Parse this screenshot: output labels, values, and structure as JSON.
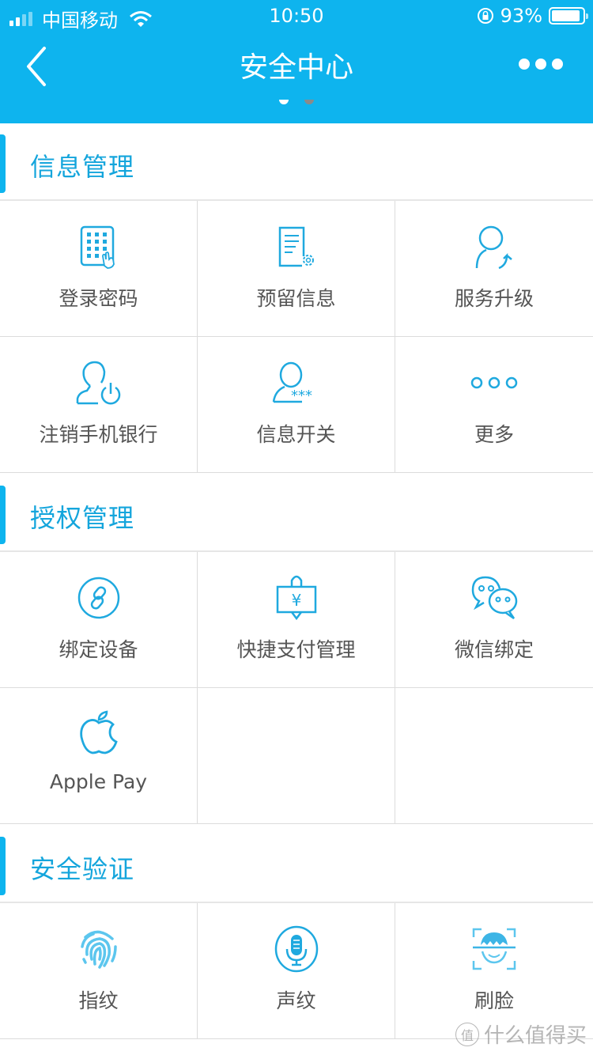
{
  "status_bar": {
    "carrier": "中国移动",
    "time": "10:50",
    "battery_percent_text": "93%",
    "battery_level": 0.93
  },
  "nav": {
    "title": "安全中心",
    "back_icon": "chevron-left-icon",
    "more_icon": "more-dots-icon",
    "page_indicator": {
      "count": 2,
      "active": 0
    }
  },
  "colors": {
    "accent": "#0eb4ee",
    "section_title": "#14a5dc",
    "label": "#555555",
    "divider": "#dcdcdc"
  },
  "sections": [
    {
      "title": "信息管理",
      "items": [
        {
          "label": "登录密码",
          "icon": "keypad-icon"
        },
        {
          "label": "预留信息",
          "icon": "document-settings-icon"
        },
        {
          "label": "服务升级",
          "icon": "user-upgrade-icon"
        },
        {
          "label": "注销手机银行",
          "icon": "user-power-icon"
        },
        {
          "label": "信息开关",
          "icon": "user-password-icon"
        },
        {
          "label": "更多",
          "icon": "more-icon"
        }
      ]
    },
    {
      "title": "授权管理",
      "items": [
        {
          "label": "绑定设备",
          "icon": "link-icon"
        },
        {
          "label": "快捷支付管理",
          "icon": "yuan-tag-icon"
        },
        {
          "label": "微信绑定",
          "icon": "wechat-icon"
        },
        {
          "label": "Apple Pay",
          "icon": "apple-icon"
        }
      ]
    },
    {
      "title": "安全验证",
      "items": [
        {
          "label": "指纹",
          "icon": "fingerprint-icon"
        },
        {
          "label": "声纹",
          "icon": "microphone-icon"
        },
        {
          "label": "刷脸",
          "icon": "face-scan-icon"
        }
      ]
    }
  ],
  "watermark": {
    "badge": "值",
    "text": "什么值得买"
  }
}
